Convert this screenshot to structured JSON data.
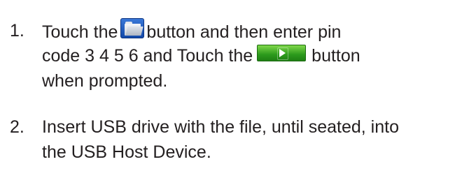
{
  "steps": [
    {
      "number": "1.",
      "line1_before": "Touch the",
      "line1_after": "button and then enter pin",
      "line2_before": "code 3 4 5 6 and Touch the",
      "line2_after": "button",
      "line3": "when prompted.",
      "icons": {
        "first": "folder-icon",
        "second": "green-arrow-icon"
      }
    },
    {
      "number": "2.",
      "line1": "Insert USB drive with the file, until seated, into",
      "line2": "the USB Host Device."
    }
  ],
  "colors": {
    "text": "#231f20",
    "folder_button": "#1f5cc0",
    "arrow_button": "#2c9a1c"
  }
}
